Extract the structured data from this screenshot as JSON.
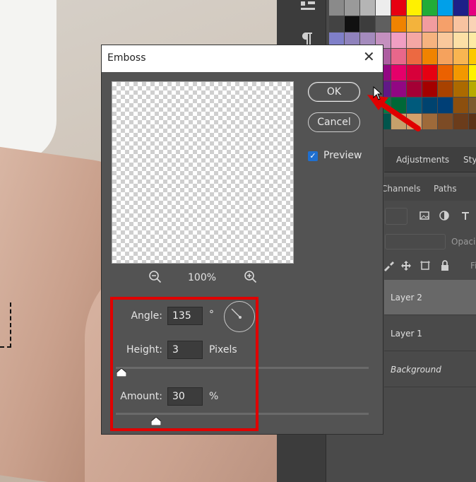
{
  "dialog": {
    "title": "Emboss",
    "ok_label": "OK",
    "cancel_label": "Cancel",
    "preview_label": "Preview",
    "preview_checked": true,
    "zoom_level": "100%",
    "angle_label": "Angle:",
    "angle_value": "135",
    "angle_unit": "°",
    "height_label": "Height:",
    "height_value": "3",
    "height_unit": "Pixels",
    "amount_label": "Amount:",
    "amount_value": "30",
    "amount_unit": "%"
  },
  "panels": {
    "tabs": [
      "Adjustments",
      "Sty"
    ],
    "subtabs": [
      "Channels",
      "Paths"
    ],
    "opacity_label": "Opaci",
    "fill_label": "Fi",
    "layers": [
      {
        "name": "Layer 2",
        "selected": true
      },
      {
        "name": "Layer 1",
        "selected": false
      },
      {
        "name": "Background",
        "selected": false
      }
    ]
  },
  "annotations": {
    "highlight_color": "#e00000",
    "arrow_color": "#e00000"
  },
  "swatch_colors": [
    "#8a8a8a",
    "#9a9a9a",
    "#b5b5b5",
    "#ededed",
    "#e60012",
    "#fff100",
    "#22ac38",
    "#00a0e9",
    "#1d2088",
    "#e4007f",
    "#434343",
    "#111111",
    "#3d3d3d",
    "#5f5f5f",
    "#f08300",
    "#f3b33c",
    "#f29c9f",
    "#f5a06a",
    "#f8c3a0",
    "#fad3b6",
    "#7f7fc8",
    "#8f82bc",
    "#a48bbd",
    "#c490bf",
    "#f19ec2",
    "#f4a7a4",
    "#f6b37f",
    "#f9c89c",
    "#fce0a6",
    "#fdeba4",
    "#5f52a0",
    "#7052a0",
    "#8957a1",
    "#ad5da1",
    "#e8678b",
    "#ec6941",
    "#f08300",
    "#f5a25d",
    "#f8b551",
    "#fcc800",
    "#1d2088",
    "#2e3192",
    "#5b2e8c",
    "#920783",
    "#e5006a",
    "#d7003a",
    "#e60012",
    "#eb6100",
    "#f39800",
    "#fff100",
    "#0068b7",
    "#00479d",
    "#1d2088",
    "#601986",
    "#920783",
    "#a40035",
    "#a40000",
    "#a84200",
    "#ac6a00",
    "#b7aa00",
    "#00736d",
    "#005e3c",
    "#00a29a",
    "#007b43",
    "#006837",
    "#005a7c",
    "#00436f",
    "#003f76",
    "#8c4f0e",
    "#7d5b2f",
    "#1d3b3a",
    "#006a5c",
    "#004d44",
    "#00554c",
    "#c5a06b",
    "#d4a06b",
    "#9e6a3a",
    "#7c4b25",
    "#6b3c1b",
    "#5c3317"
  ]
}
